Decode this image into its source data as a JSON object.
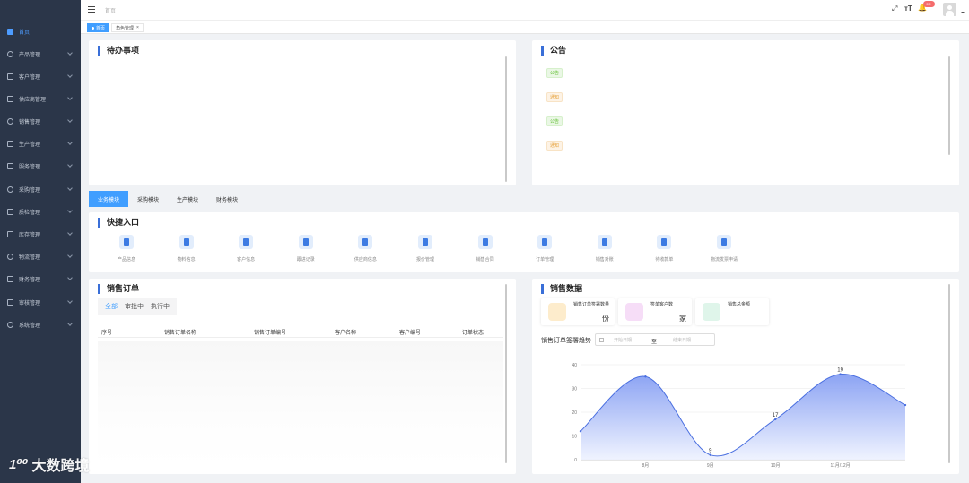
{
  "sidebar": {
    "items": [
      {
        "label": "首页",
        "icon": "home-icon",
        "active": true,
        "children": false
      },
      {
        "label": "产品管理",
        "icon": "product-icon",
        "children": true
      },
      {
        "label": "客户管理",
        "icon": "customer-icon",
        "children": true
      },
      {
        "label": "供应商管理",
        "icon": "supplier-icon",
        "children": true
      },
      {
        "label": "销售管理",
        "icon": "sales-icon",
        "children": true
      },
      {
        "label": "生产管理",
        "icon": "production-icon",
        "children": true
      },
      {
        "label": "服务管理",
        "icon": "service-icon",
        "children": true
      },
      {
        "label": "采购管理",
        "icon": "purchase-icon",
        "children": true
      },
      {
        "label": "质检管理",
        "icon": "quality-icon",
        "children": true
      },
      {
        "label": "库存管理",
        "icon": "inventory-icon",
        "children": true
      },
      {
        "label": "物流管理",
        "icon": "logistics-icon",
        "children": true
      },
      {
        "label": "财务管理",
        "icon": "finance-icon",
        "children": true
      },
      {
        "label": "审核管理",
        "icon": "audit-icon",
        "children": true
      },
      {
        "label": "系统管理",
        "icon": "system-icon",
        "children": true
      }
    ]
  },
  "header": {
    "breadcrumb": "首页",
    "badge": "99+"
  },
  "tags": [
    {
      "label": "首页",
      "active": true
    },
    {
      "label": "角色管理",
      "active": false,
      "close": "×"
    }
  ],
  "todo": {
    "title": "待办事项"
  },
  "notice": {
    "title": "公告",
    "items": [
      {
        "tag": "公告",
        "color": "green"
      },
      {
        "tag": "通知",
        "color": "orange"
      },
      {
        "tag": "公告",
        "color": "green"
      },
      {
        "tag": "通知",
        "color": "orange"
      }
    ]
  },
  "modules": {
    "tabs": [
      {
        "label": "业务模块",
        "active": true
      },
      {
        "label": "采购模块",
        "active": false
      },
      {
        "label": "生产模块",
        "active": false
      },
      {
        "label": "财务模块",
        "active": false
      }
    ]
  },
  "quick": {
    "title": "快捷入口",
    "items": [
      "产品信息",
      "物料信息",
      "客户信息",
      "跟进记录",
      "供应商信息",
      "报价管理",
      "销售合同",
      "订单管理",
      "销售对账",
      "待收款单",
      "物流发票申请"
    ]
  },
  "sales_order": {
    "title": "销售订单",
    "tabs": [
      {
        "label": "全部",
        "active": true
      },
      {
        "label": "审批中",
        "active": false
      },
      {
        "label": "执行中",
        "active": false
      }
    ],
    "columns": [
      "序号",
      "销售订单名称",
      "销售订单编号",
      "客户名称",
      "客户编号",
      "订单状态"
    ]
  },
  "sales_data": {
    "title": "销售数据",
    "stats": [
      {
        "title": "销售订单签署数量",
        "unit": "份",
        "color": "#fdeccc",
        "accent": "#e6a23c"
      },
      {
        "title": "签单客户数",
        "unit": "家",
        "color": "#f6ddf7",
        "accent": "#c25bd6"
      },
      {
        "title": "销售总金额",
        "unit": "",
        "color": "#dff5ea",
        "accent": "#3bb57a"
      }
    ],
    "trend_label": "销售订单签署趋势",
    "date_start_placeholder": "开始日期",
    "date_sep": "至",
    "date_end_placeholder": "结束日期"
  },
  "chart_data": {
    "type": "area",
    "categories": [
      "",
      "8月",
      "9月",
      "10月",
      "11月",
      "12月"
    ],
    "series": [
      {
        "values": [
          12,
          35,
          2,
          17,
          36,
          23
        ]
      }
    ],
    "point_labels": [
      "",
      "",
      "9",
      "17",
      "19",
      ""
    ],
    "x_labels": [
      "",
      "8月",
      "9月",
      "10月",
      "11月/12月",
      ""
    ],
    "ylim": [
      0,
      40
    ],
    "yticks": [
      0,
      10,
      20,
      30,
      40
    ],
    "grid": true,
    "colors": {
      "line": "#4a6fe0",
      "fill_top": "#7f99f2",
      "fill_bottom": "#eef2ff"
    }
  },
  "watermark": {
    "logo": "1⁰⁰",
    "text": "大数跨境"
  }
}
